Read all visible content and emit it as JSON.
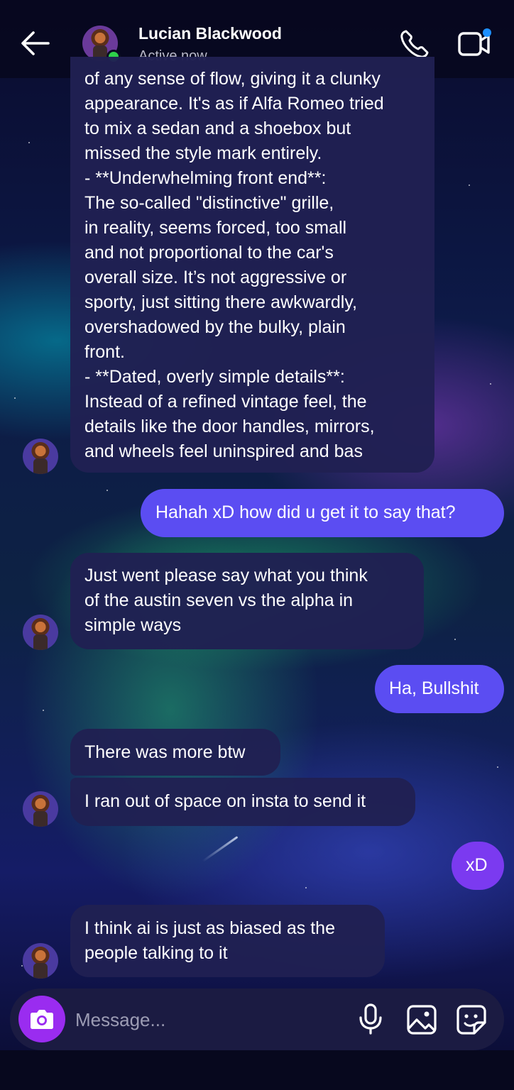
{
  "header": {
    "contact_name": "Lucian Blackwood",
    "status": "Active now",
    "online_color": "#2ed14a",
    "icons": [
      "back-arrow-icon",
      "phone-icon",
      "video-camera-icon"
    ]
  },
  "messages": [
    {
      "direction": "incoming",
      "lines": [
        "of any sense of flow, giving it a clunky",
        "appearance. It's as if Alfa Romeo tried",
        "to mix a sedan and a shoebox but",
        "missed the style mark entirely.",
        "- **Underwhelming front end**:",
        "The so-called \"distinctive\" grille,",
        "in reality, seems forced, too small",
        "and not proportional to the car's",
        "overall size. It’s not aggressive or",
        "sporty, just sitting there awkwardly,",
        "overshadowed by the bulky, plain",
        "front.",
        "- **Dated, overly simple details**:",
        "Instead of a refined vintage feel, the",
        "details like the door handles, mirrors,",
        "and wheels feel uninspired and bas"
      ]
    },
    {
      "direction": "outgoing",
      "text": "Hahah xD how did u get it to say that?"
    },
    {
      "direction": "incoming",
      "lines": [
        "Just went please say what you think",
        "of the austin seven vs the alpha in",
        "simple ways"
      ]
    },
    {
      "direction": "outgoing",
      "text": "Ha, Bullshit"
    },
    {
      "direction": "incoming",
      "text": "There was more btw"
    },
    {
      "direction": "incoming",
      "text": "I ran out of space on insta to send it"
    },
    {
      "direction": "outgoing",
      "text": "xD"
    },
    {
      "direction": "incoming",
      "lines": [
        "I think ai is just as biased as the",
        "people talking to it"
      ]
    }
  ],
  "composer": {
    "placeholder": "Message...",
    "icons": [
      "camera-icon",
      "microphone-icon",
      "gallery-icon",
      "sticker-icon"
    ],
    "camera_button_color": "#9a2cf0"
  },
  "colors": {
    "incoming_bubble": "#202052",
    "outgoing_bubble": "#5b4df2",
    "outgoing_bubble_alt": "#7b3af0"
  }
}
